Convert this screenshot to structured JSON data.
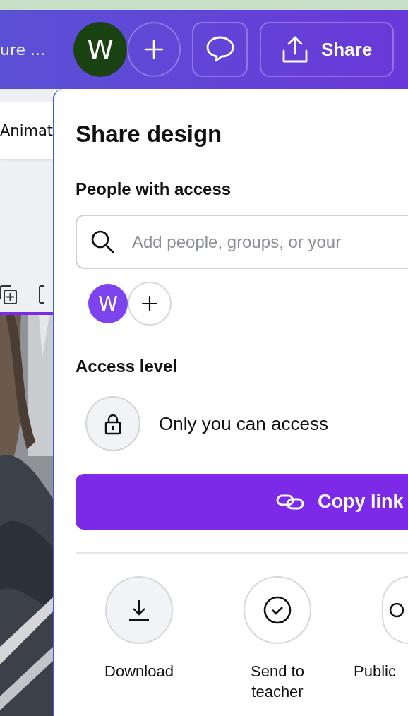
{
  "header": {
    "title": "ure ...",
    "avatar": {
      "initial": "W"
    },
    "share_button": {
      "label": "Share"
    }
  },
  "editor": {
    "tab": {
      "label": "Animat"
    }
  },
  "share_panel": {
    "title": "Share design",
    "people_heading": "People with access",
    "search": {
      "placeholder": "Add people, groups, or your"
    },
    "people": [
      {
        "initial": "W"
      }
    ],
    "access_heading": "Access level",
    "access": {
      "label": "Only you can access"
    },
    "copy_button": {
      "label": "Copy link"
    },
    "actions": [
      {
        "label": "Download",
        "kind": "download",
        "highlighted": true
      },
      {
        "label": "Send to teacher",
        "kind": "teacher",
        "highlighted": false
      },
      {
        "label": "Public",
        "kind": "public",
        "highlighted": false
      }
    ]
  }
}
